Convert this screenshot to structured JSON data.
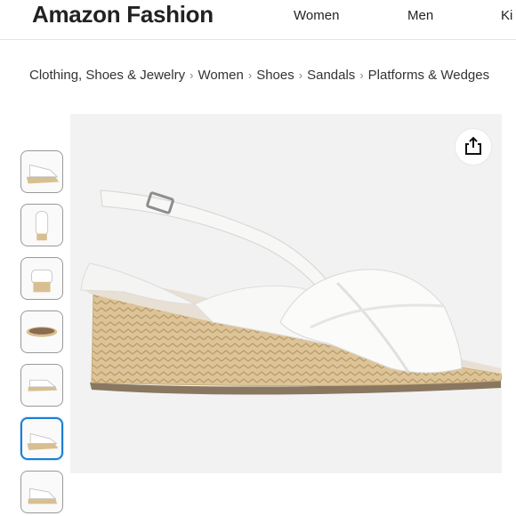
{
  "header": {
    "brand": "Amazon Fashion",
    "nav": [
      "Women",
      "Men",
      "Ki"
    ]
  },
  "breadcrumb": [
    "Clothing, Shoes & Jewelry",
    "Women",
    "Shoes",
    "Sandals",
    "Platforms & Wedges"
  ],
  "product": {
    "thumbnail_count": 7,
    "selected_thumbnail": 6
  },
  "colors": {
    "selected_border": "#1a7fd4",
    "image_background": "#f2f2f2",
    "jute": "#d8bf91"
  }
}
